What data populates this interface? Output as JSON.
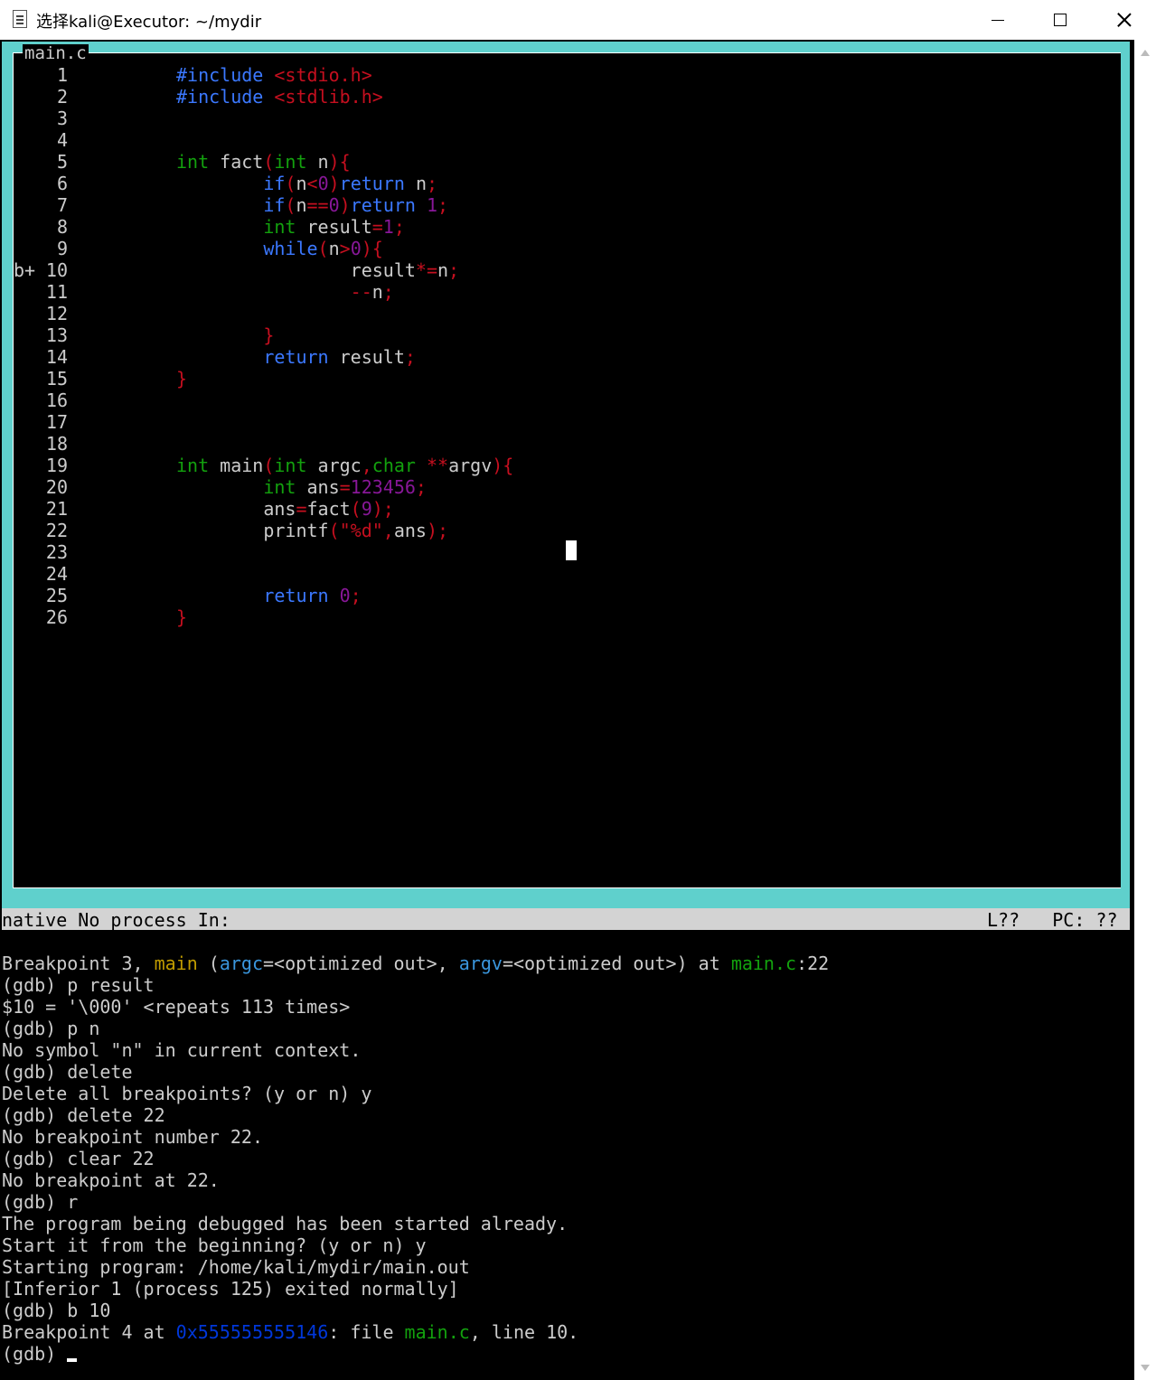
{
  "window": {
    "title": "选择kali@Executor: ~/mydir",
    "minimize_icon": "minimize-icon",
    "maximize_icon": "maximize-icon",
    "close_icon": "close-icon"
  },
  "source": {
    "filename": "main.c",
    "lines": [
      {
        "n": "1",
        "bp": "",
        "segs": [
          [
            "pp",
            "#include "
          ],
          [
            "str",
            "<stdio.h>"
          ]
        ]
      },
      {
        "n": "2",
        "bp": "",
        "segs": [
          [
            "pp",
            "#include "
          ],
          [
            "str",
            "<stdlib.h>"
          ]
        ]
      },
      {
        "n": "3",
        "bp": "",
        "segs": []
      },
      {
        "n": "4",
        "bp": "",
        "segs": []
      },
      {
        "n": "5",
        "bp": "",
        "segs": [
          [
            "ty",
            "int"
          ],
          [
            "var",
            " fact"
          ],
          [
            "pun",
            "("
          ],
          [
            "ty",
            "int"
          ],
          [
            "var",
            " n"
          ],
          [
            "pun",
            "){"
          ]
        ]
      },
      {
        "n": "6",
        "bp": "",
        "segs": [
          [
            "var",
            "        "
          ],
          [
            "kw",
            "if"
          ],
          [
            "pun",
            "("
          ],
          [
            "var",
            "n"
          ],
          [
            "pun",
            "<"
          ],
          [
            "num",
            "0"
          ],
          [
            "pun",
            ")"
          ],
          [
            "kw",
            "return"
          ],
          [
            "var",
            " n"
          ],
          [
            "pun",
            ";"
          ]
        ]
      },
      {
        "n": "7",
        "bp": "",
        "segs": [
          [
            "var",
            "        "
          ],
          [
            "kw",
            "if"
          ],
          [
            "pun",
            "("
          ],
          [
            "var",
            "n"
          ],
          [
            "pun",
            "=="
          ],
          [
            "num",
            "0"
          ],
          [
            "pun",
            ")"
          ],
          [
            "kw",
            "return"
          ],
          [
            "var",
            " "
          ],
          [
            "num",
            "1"
          ],
          [
            "pun",
            ";"
          ]
        ]
      },
      {
        "n": "8",
        "bp": "",
        "segs": [
          [
            "var",
            "        "
          ],
          [
            "ty",
            "int"
          ],
          [
            "var",
            " result"
          ],
          [
            "pun",
            "="
          ],
          [
            "num",
            "1"
          ],
          [
            "pun",
            ";"
          ]
        ]
      },
      {
        "n": "9",
        "bp": "",
        "segs": [
          [
            "var",
            "        "
          ],
          [
            "kw",
            "while"
          ],
          [
            "pun",
            "("
          ],
          [
            "var",
            "n"
          ],
          [
            "pun",
            ">"
          ],
          [
            "num",
            "0"
          ],
          [
            "pun",
            "){"
          ]
        ]
      },
      {
        "n": "10",
        "bp": "b+",
        "segs": [
          [
            "var",
            "                result"
          ],
          [
            "pun",
            "*="
          ],
          [
            "var",
            "n"
          ],
          [
            "pun",
            ";"
          ]
        ]
      },
      {
        "n": "11",
        "bp": "",
        "segs": [
          [
            "var",
            "                "
          ],
          [
            "pun",
            "--"
          ],
          [
            "var",
            "n"
          ],
          [
            "pun",
            ";"
          ]
        ]
      },
      {
        "n": "12",
        "bp": "",
        "segs": []
      },
      {
        "n": "13",
        "bp": "",
        "segs": [
          [
            "var",
            "        "
          ],
          [
            "pun",
            "}"
          ]
        ]
      },
      {
        "n": "14",
        "bp": "",
        "segs": [
          [
            "var",
            "        "
          ],
          [
            "kw",
            "return"
          ],
          [
            "var",
            " result"
          ],
          [
            "pun",
            ";"
          ]
        ]
      },
      {
        "n": "15",
        "bp": "",
        "segs": [
          [
            "pun",
            "}"
          ]
        ]
      },
      {
        "n": "16",
        "bp": "",
        "segs": []
      },
      {
        "n": "17",
        "bp": "",
        "segs": []
      },
      {
        "n": "18",
        "bp": "",
        "segs": []
      },
      {
        "n": "19",
        "bp": "",
        "segs": [
          [
            "ty",
            "int"
          ],
          [
            "var",
            " main"
          ],
          [
            "pun",
            "("
          ],
          [
            "ty",
            "int"
          ],
          [
            "var",
            " argc"
          ],
          [
            "pun",
            ","
          ],
          [
            "ty",
            "char"
          ],
          [
            "var",
            " "
          ],
          [
            "pun",
            "**"
          ],
          [
            "var",
            "argv"
          ],
          [
            "pun",
            "){"
          ]
        ]
      },
      {
        "n": "20",
        "bp": "",
        "segs": [
          [
            "var",
            "        "
          ],
          [
            "ty",
            "int"
          ],
          [
            "var",
            " ans"
          ],
          [
            "pun",
            "="
          ],
          [
            "num",
            "123456"
          ],
          [
            "pun",
            ";"
          ]
        ]
      },
      {
        "n": "21",
        "bp": "",
        "segs": [
          [
            "var",
            "        ans"
          ],
          [
            "pun",
            "="
          ],
          [
            "var",
            "fact"
          ],
          [
            "pun",
            "("
          ],
          [
            "num",
            "9"
          ],
          [
            "pun",
            ");"
          ]
        ]
      },
      {
        "n": "22",
        "bp": "",
        "segs": [
          [
            "var",
            "        printf"
          ],
          [
            "pun",
            "("
          ],
          [
            "str",
            "\"%d\""
          ],
          [
            "pun",
            ","
          ],
          [
            "var",
            "ans"
          ],
          [
            "pun",
            ");"
          ]
        ]
      },
      {
        "n": "23",
        "bp": "",
        "segs": []
      },
      {
        "n": "24",
        "bp": "",
        "segs": []
      },
      {
        "n": "25",
        "bp": "",
        "segs": [
          [
            "var",
            "        "
          ],
          [
            "kw",
            "return"
          ],
          [
            "var",
            " "
          ],
          [
            "num",
            "0"
          ],
          [
            "pun",
            ";"
          ]
        ]
      },
      {
        "n": "26",
        "bp": "",
        "segs": [
          [
            "pun",
            "}"
          ]
        ]
      }
    ]
  },
  "status": {
    "left": "native No process In:",
    "right": "L??   PC: ??"
  },
  "gdb": {
    "lines": [
      [
        [
          "t",
          "Breakpoint 3, "
        ],
        [
          "func",
          "main"
        ],
        [
          "t",
          " ("
        ],
        [
          "var",
          "argc"
        ],
        [
          "t",
          "=<optimized out>, "
        ],
        [
          "var",
          "argv"
        ],
        [
          "t",
          "=<optimized out>) at "
        ],
        [
          "file",
          "main.c"
        ],
        [
          "t",
          ":22"
        ]
      ],
      [
        [
          "t",
          "(gdb) p result"
        ]
      ],
      [
        [
          "t",
          "$10 = '\\000' <repeats 113 times>"
        ]
      ],
      [
        [
          "t",
          "(gdb) p n"
        ]
      ],
      [
        [
          "t",
          "No symbol \"n\" in current context."
        ]
      ],
      [
        [
          "t",
          "(gdb) delete"
        ]
      ],
      [
        [
          "t",
          "Delete all breakpoints? (y or n) y"
        ]
      ],
      [
        [
          "t",
          "(gdb) delete 22"
        ]
      ],
      [
        [
          "t",
          "No breakpoint number 22."
        ]
      ],
      [
        [
          "t",
          "(gdb) clear 22"
        ]
      ],
      [
        [
          "t",
          "No breakpoint at 22."
        ]
      ],
      [
        [
          "t",
          "(gdb) r"
        ]
      ],
      [
        [
          "t",
          "The program being debugged has been started already."
        ]
      ],
      [
        [
          "t",
          "Start it from the beginning? (y or n) y"
        ]
      ],
      [
        [
          "t",
          "Starting program: /home/kali/mydir/main.out"
        ]
      ],
      [
        [
          "t",
          "[Inferior 1 (process 125) exited normally]"
        ]
      ],
      [
        [
          "t",
          "(gdb) b 10"
        ]
      ],
      [
        [
          "t",
          "Breakpoint 4 at "
        ],
        [
          "addr",
          "0x555555555146"
        ],
        [
          "t",
          ": file "
        ],
        [
          "file",
          "main.c"
        ],
        [
          "t",
          ", line 10."
        ]
      ]
    ],
    "prompt": "(gdb) "
  }
}
